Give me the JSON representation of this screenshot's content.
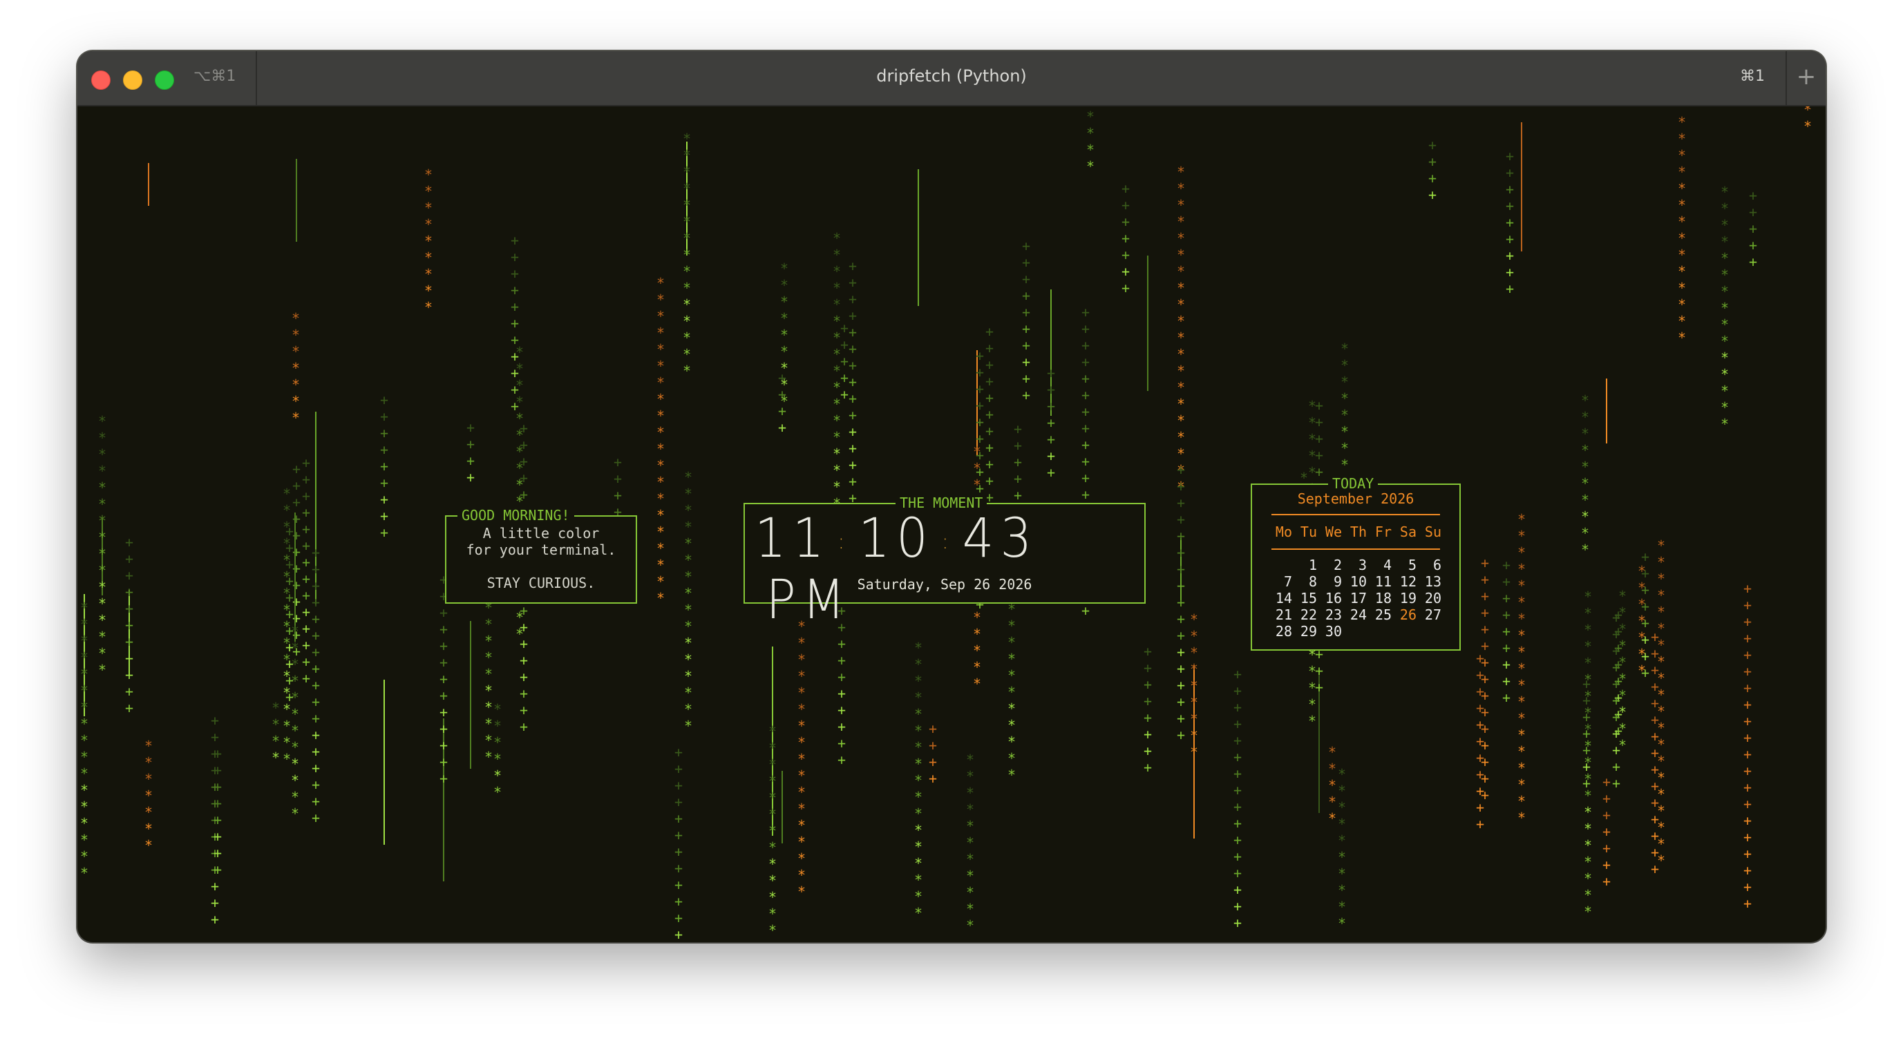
{
  "window": {
    "title": "dripfetch (Python)",
    "tab_shortcut_left": "⌥⌘1",
    "tab_shortcut_right": "⌘1",
    "new_tab_glyph": "+"
  },
  "colors": {
    "background": "#14140b",
    "accent_green": "#86c736",
    "accent_orange": "#f08a24",
    "text": "#e4e4da"
  },
  "greeting": {
    "label": "GOOD MORNING!",
    "lines": [
      "A little color",
      "for your terminal.",
      "",
      "STAY CURIOUS."
    ]
  },
  "moment": {
    "label": "THE MOMENT",
    "hour": "11",
    "minute": "10",
    "second": "43",
    "ampm": "PM",
    "date": "Saturday, Sep 26 2026"
  },
  "calendar": {
    "label": "TODAY",
    "month_title": "September 2026",
    "weekdays": [
      "Mo",
      "Tu",
      "We",
      "Th",
      "Fr",
      "Sa",
      "Su"
    ],
    "weeks": [
      [
        "",
        "1",
        "2",
        "3",
        "4",
        "5",
        "6"
      ],
      [
        "7",
        "8",
        "9",
        "10",
        "11",
        "12",
        "13"
      ],
      [
        "14",
        "15",
        "16",
        "17",
        "18",
        "19",
        "20"
      ],
      [
        "21",
        "22",
        "23",
        "24",
        "25",
        "26",
        "27"
      ],
      [
        "28",
        "29",
        "30",
        "",
        "",
        "",
        ""
      ]
    ],
    "today": "26"
  }
}
